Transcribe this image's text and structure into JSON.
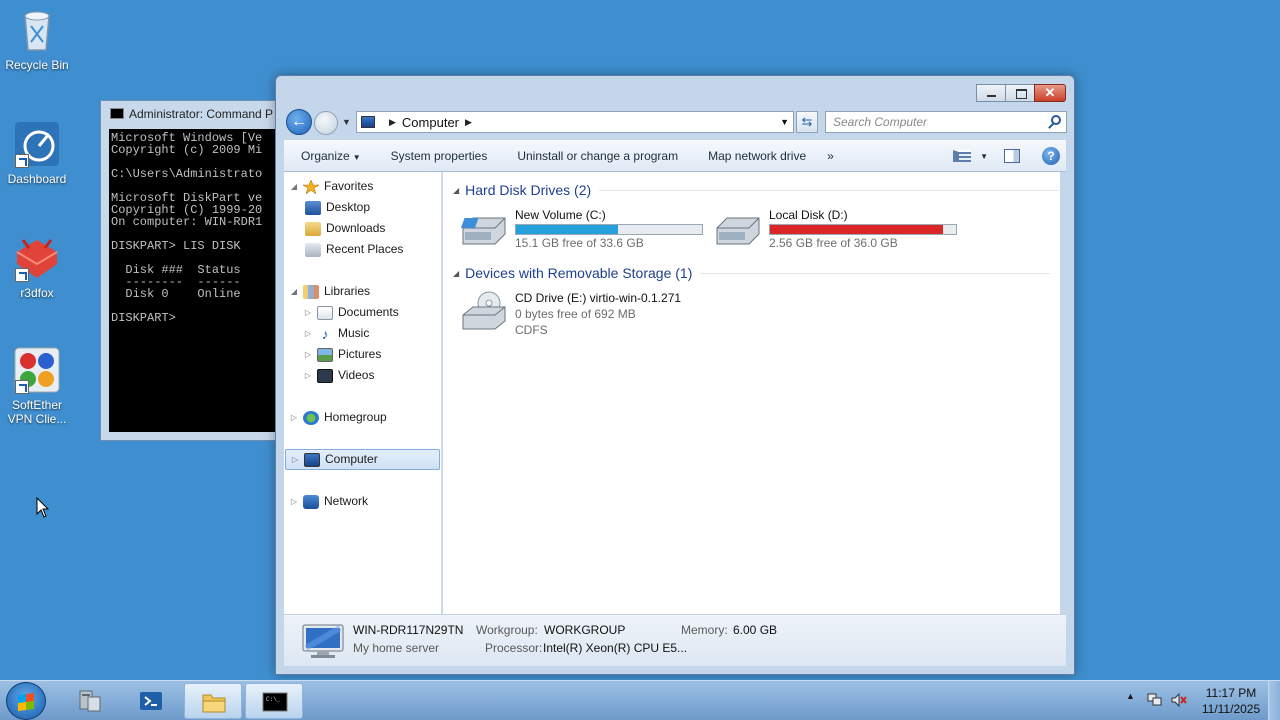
{
  "desktop": {
    "icons": [
      {
        "label": "Recycle Bin",
        "icon": "recycle-bin-icon"
      },
      {
        "label": "Dashboard",
        "icon": "dashboard-icon"
      },
      {
        "label": "r3dfox",
        "icon": "r3dfox-icon"
      },
      {
        "label": "SoftEther VPN Clie...",
        "icon": "softether-vpn-icon"
      }
    ]
  },
  "cmd": {
    "title": "Administrator: Command P",
    "lines": "Microsoft Windows [Ve\nCopyright (c) 2009 Mi\n\nC:\\Users\\Administrato\n\nMicrosoft DiskPart ve\nCopyright (C) 1999-20\nOn computer: WIN-RDR1\n\nDISKPART> LIS DISK\n\n  Disk ###  Status\n  --------  ------\n  Disk 0    Online\n\nDISKPART>"
  },
  "explorer": {
    "address": {
      "location": "Computer"
    },
    "search": {
      "placeholder": "Search Computer"
    },
    "toolbar": {
      "organize": "Organize",
      "system_properties": "System properties",
      "uninstall": "Uninstall or change a program",
      "map_drive": "Map network drive",
      "more": "»"
    },
    "nav": {
      "favorites": "Favorites",
      "desktop": "Desktop",
      "downloads": "Downloads",
      "recent_places": "Recent Places",
      "libraries": "Libraries",
      "documents": "Documents",
      "music": "Music",
      "pictures": "Pictures",
      "videos": "Videos",
      "homegroup": "Homegroup",
      "computer": "Computer",
      "network": "Network"
    },
    "groups": {
      "hard_disks": "Hard Disk Drives (2)",
      "removable": "Devices with Removable Storage (1)"
    },
    "drives": {
      "c": {
        "name": "New Volume (C:)",
        "free": "15.1 GB free of 33.6 GB",
        "used_fraction": 0.55,
        "bar_color": "#26a0da"
      },
      "d": {
        "name": "Local Disk (D:)",
        "free": "2.56 GB free of 36.0 GB",
        "used_fraction": 0.93,
        "bar_color": "#da2626"
      },
      "e": {
        "name": "CD Drive (E:) virtio-win-0.1.271",
        "free": "0 bytes free of 692 MB",
        "fs": "CDFS"
      }
    },
    "details": {
      "computer_name": "WIN-RDR117N29TN",
      "description": "My home server",
      "workgroup_label": "Workgroup:",
      "workgroup": "WORKGROUP",
      "memory_label": "Memory:",
      "memory": "6.00 GB",
      "processor_label": "Processor:",
      "processor": "Intel(R) Xeon(R) CPU E5..."
    }
  },
  "taskbar": {
    "time": "11:17 PM",
    "date": "11/11/2025"
  }
}
